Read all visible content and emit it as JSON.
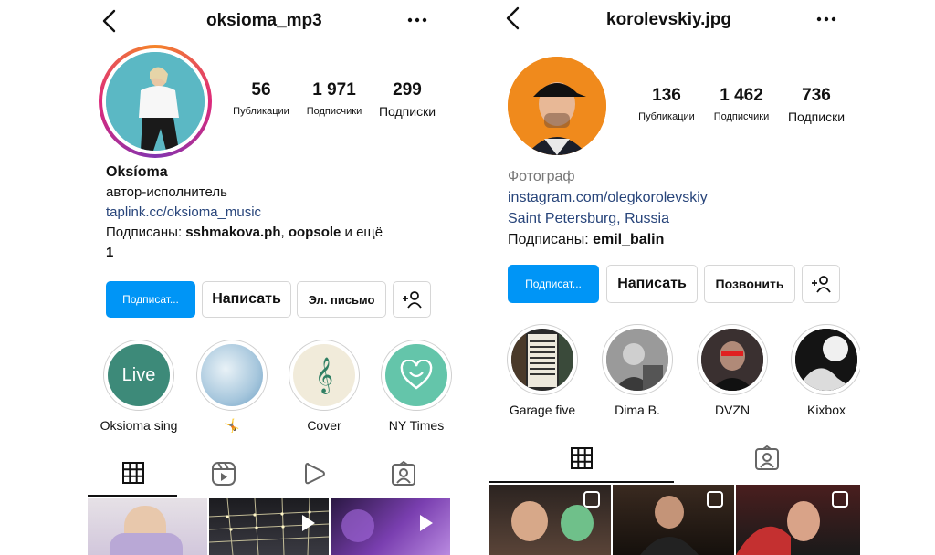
{
  "left": {
    "username": "oksioma_mp3",
    "stats": [
      {
        "value": "56",
        "label": "Публикации"
      },
      {
        "value": "1 971",
        "label": "Подписчики"
      },
      {
        "value": "299",
        "label": "Подписки"
      }
    ],
    "name": "Oksíoma",
    "bio_line": "автор-исполнитель",
    "link": "taplink.cc/oksioma_music",
    "followed_prefix": "Подписаны: ",
    "followed_user1": "sshmakova.ph",
    "followed_sep": ", ",
    "followed_user2": "oopsole",
    "followed_rest": " и ещё",
    "followed_more": "1",
    "buttons": {
      "follow": "Подписат...",
      "message": "Написать",
      "email": "Эл. письмо"
    },
    "highlights": [
      {
        "label": "Oksioma sing",
        "cover_text": "Live"
      },
      {
        "label": "🤸",
        "cover_text": ""
      },
      {
        "label": "Cover",
        "cover_text": "𝄞"
      },
      {
        "label": "NY Times",
        "cover_text": ""
      }
    ],
    "colors": {
      "live_cover": "#3d8a79",
      "cover_bg": "#f1ebda",
      "nyt_bg": "#64c5aa"
    }
  },
  "right": {
    "username": "korolevskiy.jpg",
    "stats": [
      {
        "value": "136",
        "label": "Публикации"
      },
      {
        "value": "1 462",
        "label": "Подписчики"
      },
      {
        "value": "736",
        "label": "Подписки"
      }
    ],
    "category": "Фотограф",
    "link": "instagram.com/olegkorolevskiy",
    "location": "Saint Petersburg, Russia",
    "followed_prefix": "Подписаны: ",
    "followed_user1": "emil_balin",
    "buttons": {
      "follow": "Подписат...",
      "message": "Написать",
      "call": "Позвонить"
    },
    "highlights": [
      {
        "label": "Garage five"
      },
      {
        "label": "Dima B."
      },
      {
        "label": "DVZN"
      },
      {
        "label": "Kixbox"
      }
    ]
  },
  "colors": {
    "accent": "#0095f6",
    "link": "#27447a",
    "avatar_bg_left": "#5bb8c4",
    "avatar_bg_right": "#f08a1c"
  }
}
